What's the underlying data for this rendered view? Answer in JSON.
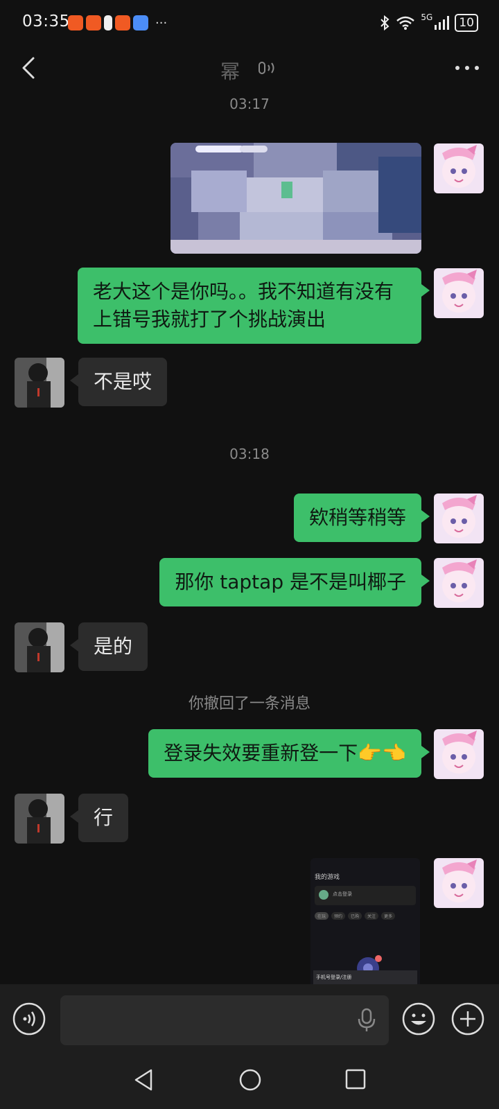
{
  "status_bar": {
    "time": "03:35",
    "network": "5G",
    "battery": "10",
    "more": "···"
  },
  "header": {
    "contact_name": "幂",
    "menu": "···"
  },
  "messages": {
    "ts1": "03:17",
    "msg_me_1": "老大这个是你吗。。我不知道有没有上错号我就打了个挑战演出",
    "msg_them_1": "不是哎",
    "ts2": "03:18",
    "msg_me_2": "欸稍等稍等",
    "msg_me_3": "那你 taptap 是不是叫椰子",
    "msg_them_2": "是的",
    "recall": "你撤回了一条消息",
    "msg_me_4": "登录失效要重新登一下👉👈",
    "msg_them_3": "行"
  },
  "screenshot_preview": {
    "title": "我的游戏",
    "login_hint": "点击登录",
    "bottom_text": "手机号登录/注册",
    "tabs": [
      "在玩",
      "预约",
      "已购",
      "关注",
      "更多"
    ]
  },
  "input": {
    "placeholder": ""
  },
  "colors": {
    "background": "#111111",
    "bubble_me": "#3dbf6a",
    "bubble_them": "#2c2c2c",
    "bar": "#1e1e1e"
  },
  "icons": [
    "back-arrow-icon",
    "voice-call-icon",
    "more-icon",
    "voice-input-icon",
    "mic-icon",
    "emoji-icon",
    "plus-icon",
    "nav-back-icon",
    "nav-home-icon",
    "nav-recent-icon"
  ]
}
